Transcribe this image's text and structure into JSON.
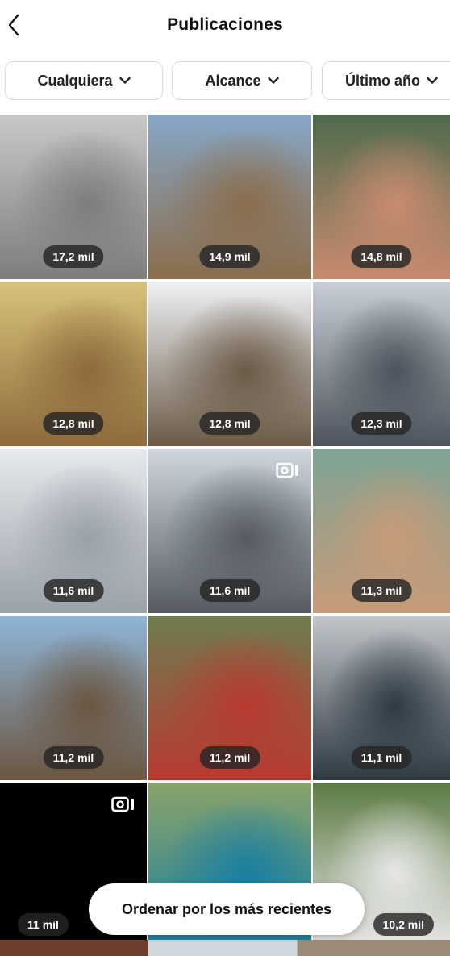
{
  "header": {
    "title": "Publicaciones"
  },
  "filters": [
    {
      "label": "Cualquiera"
    },
    {
      "label": "Alcance"
    },
    {
      "label": "Último año"
    }
  ],
  "posts": [
    {
      "views": "17,2 mil",
      "colors": [
        "#c8c8c8",
        "#7d7d7d"
      ],
      "reel": false
    },
    {
      "views": "14,9 mil",
      "colors": [
        "#87a7c7",
        "#8a6d4c"
      ],
      "reel": false
    },
    {
      "views": "14,8 mil",
      "colors": [
        "#4e6b4e",
        "#c98b6f"
      ],
      "reel": false
    },
    {
      "views": "12,8 mil",
      "colors": [
        "#d8c27a",
        "#8d6b3c"
      ],
      "reel": false
    },
    {
      "views": "12,8 mil",
      "colors": [
        "#eef1f4",
        "#6b5a47"
      ],
      "reel": false
    },
    {
      "views": "12,3 mil",
      "colors": [
        "#c9cfd6",
        "#4b545c"
      ],
      "reel": false
    },
    {
      "views": "11,6 mil",
      "colors": [
        "#e7eaee",
        "#9aa1a8"
      ],
      "reel": false
    },
    {
      "views": "11,6 mil",
      "colors": [
        "#cfd6de",
        "#555b60"
      ],
      "reel": true
    },
    {
      "views": "11,3 mil",
      "colors": [
        "#7ea395",
        "#c79b78"
      ],
      "reel": false
    },
    {
      "views": "11,2 mil",
      "colors": [
        "#8fb6d8",
        "#6b5641"
      ],
      "reel": false
    },
    {
      "views": "11,2 mil",
      "colors": [
        "#6e7d4f",
        "#b83a2f"
      ],
      "reel": false
    },
    {
      "views": "11,1 mil",
      "colors": [
        "#c2c6ca",
        "#2f3a43"
      ],
      "reel": false
    },
    {
      "views": "11 mil",
      "colors": [
        "#000000",
        "#000000"
      ],
      "reel": true
    },
    {
      "views": "",
      "colors": [
        "#8aa36a",
        "#1b7fa0"
      ],
      "reel": false
    },
    {
      "views": "10,2 mil",
      "colors": [
        "#5c7b43",
        "#e7e7e7"
      ],
      "reel": false
    }
  ],
  "toast": {
    "label": "Ordenar por los más recientes"
  }
}
